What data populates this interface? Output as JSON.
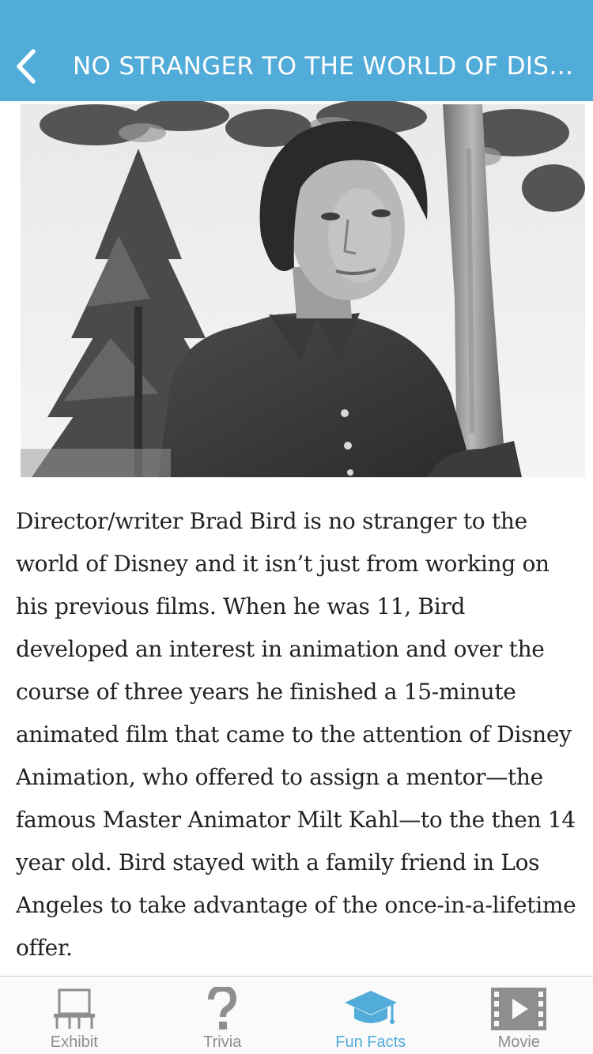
{
  "header": {
    "title": "NO STRANGER TO THE WORLD OF DISNEY"
  },
  "photo": {
    "subject": "black-and-white photo of a young Brad Bird standing by a tree"
  },
  "article": {
    "body": "Director/writer Brad Bird is no stranger to the world of Disney and it isn’t just from working on his previous films. When he was 11, Bird developed an interest in animation and over the course of three years he finished a 15-minute animated film that came to the attention of Disney Animation, who offered to assign a mentor—the famous Master Animator Milt Kahl—to the then 14 year old. Bird stayed with a family friend in Los Angeles to take advantage of the once-in-a-lifetime offer."
  },
  "tabs": [
    {
      "label": "Exhibit",
      "icon": "exhibit-icon",
      "active": false
    },
    {
      "label": "Trivia",
      "icon": "question-mark-icon",
      "active": false
    },
    {
      "label": "Fun Facts",
      "icon": "graduation-cap-icon",
      "active": true
    },
    {
      "label": "Movie",
      "icon": "film-play-icon",
      "active": false
    }
  ],
  "colors": {
    "accent": "#52acd9",
    "inactive": "#8e8e8e"
  }
}
